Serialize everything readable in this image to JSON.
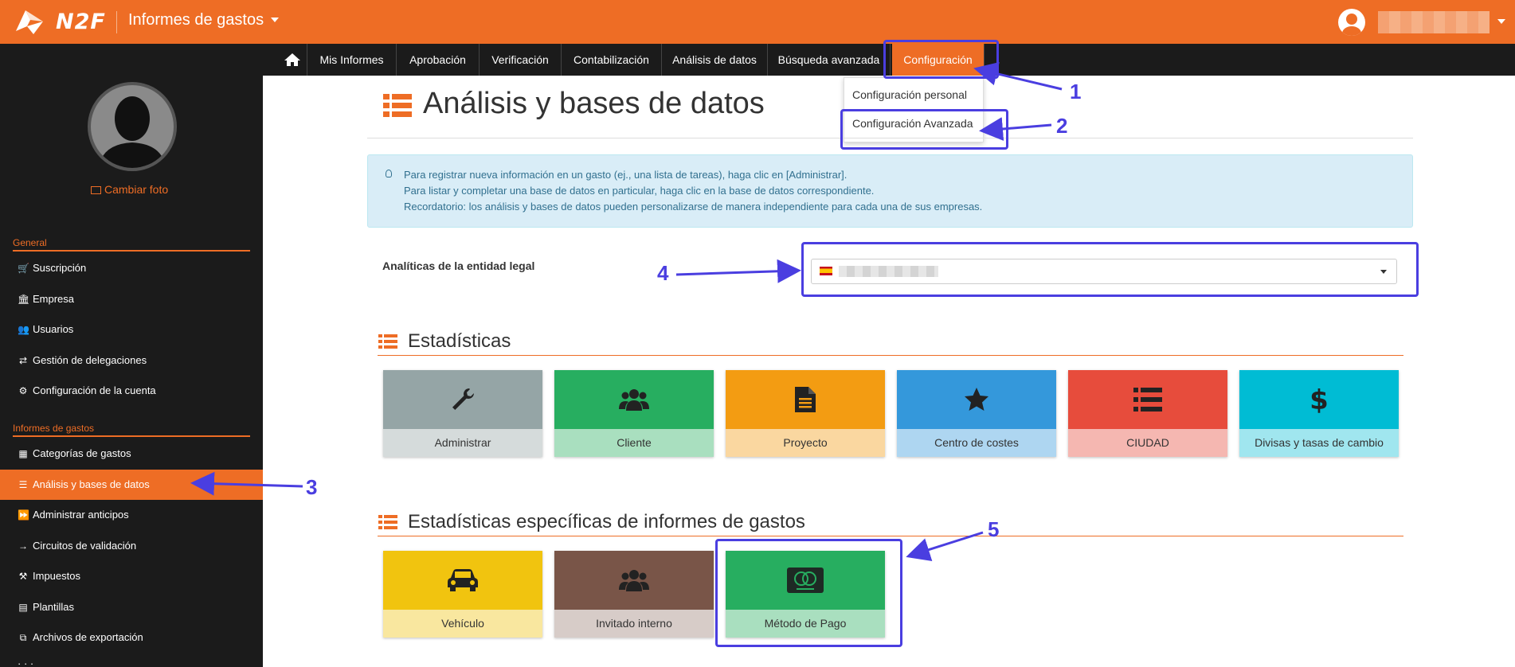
{
  "header": {
    "logo_text": "N2F",
    "app_title": "Informes de gastos"
  },
  "nav": {
    "items": [
      "Mis Informes",
      "Aprobación",
      "Verificación",
      "Contabilización",
      "Análisis de datos",
      "Búsqueda avanzada",
      "Configuración"
    ],
    "active": "Configuración",
    "dropdown": [
      "Configuración personal",
      "Configuración Avanzada"
    ]
  },
  "sidebar": {
    "change_photo": "Cambiar foto",
    "sections": [
      {
        "title": "General",
        "items": [
          "Suscripción",
          "Empresa",
          "Usuarios",
          "Gestión de delegaciones",
          "Configuración de la cuenta"
        ]
      },
      {
        "title": "Informes de gastos",
        "items": [
          "Categorías de gastos",
          "Análisis y bases de datos",
          "Administrar anticipos",
          "Circuitos de validación",
          "Impuestos",
          "Plantillas",
          "Archivos de exportación"
        ]
      }
    ],
    "active": "Análisis y bases de datos"
  },
  "main": {
    "title": "Análisis y bases de datos",
    "info": [
      "Para registrar nueva información en un gasto (ej., una lista de tareas), haga clic en [Administrar].",
      "Para listar y completar una base de datos en particular, haga clic en la base de datos correspondiente.",
      "Recordatorio: los análisis y bases de datos pueden personalizarse de manera independiente para cada una de sus empresas."
    ],
    "legal_entity_label": "Analíticas de la entidad legal",
    "stats_title": "Estadísticas",
    "stats_tiles": [
      {
        "label": "Administrar",
        "icon": "wrench-icon",
        "top": "#95a5a6",
        "bottom": "#d5dbdb"
      },
      {
        "label": "Cliente",
        "icon": "users-icon",
        "top": "#27ae60",
        "bottom": "#a9dfbf"
      },
      {
        "label": "Proyecto",
        "icon": "document-icon",
        "top": "#f39c12",
        "bottom": "#fad7a0"
      },
      {
        "label": "Centro de costes",
        "icon": "star-icon",
        "top": "#3498db",
        "bottom": "#aed6f1"
      },
      {
        "label": "CIUDAD",
        "icon": "list-icon",
        "top": "#e74c3c",
        "bottom": "#f5b7b1"
      },
      {
        "label": "Divisas y tasas de cambio",
        "icon": "dollar-icon",
        "top": "#00bcd4",
        "bottom": "#a0e6ef"
      }
    ],
    "specific_title": "Estadísticas específicas de informes de gastos",
    "specific_tiles": [
      {
        "label": "Vehículo",
        "icon": "car-icon",
        "top": "#f1c40f",
        "bottom": "#f9e79f"
      },
      {
        "label": "Invitado interno",
        "icon": "users-icon",
        "top": "#795548",
        "bottom": "#d7ccc8"
      },
      {
        "label": "Método de Pago",
        "icon": "mastercard-icon",
        "top": "#27ae60",
        "bottom": "#a9dfbf"
      }
    ]
  },
  "annotations": [
    "1",
    "2",
    "3",
    "4",
    "5"
  ],
  "colors": {
    "accent": "#ee6d25",
    "annotation": "#4a3ee0",
    "dark": "#1b1b1b"
  }
}
